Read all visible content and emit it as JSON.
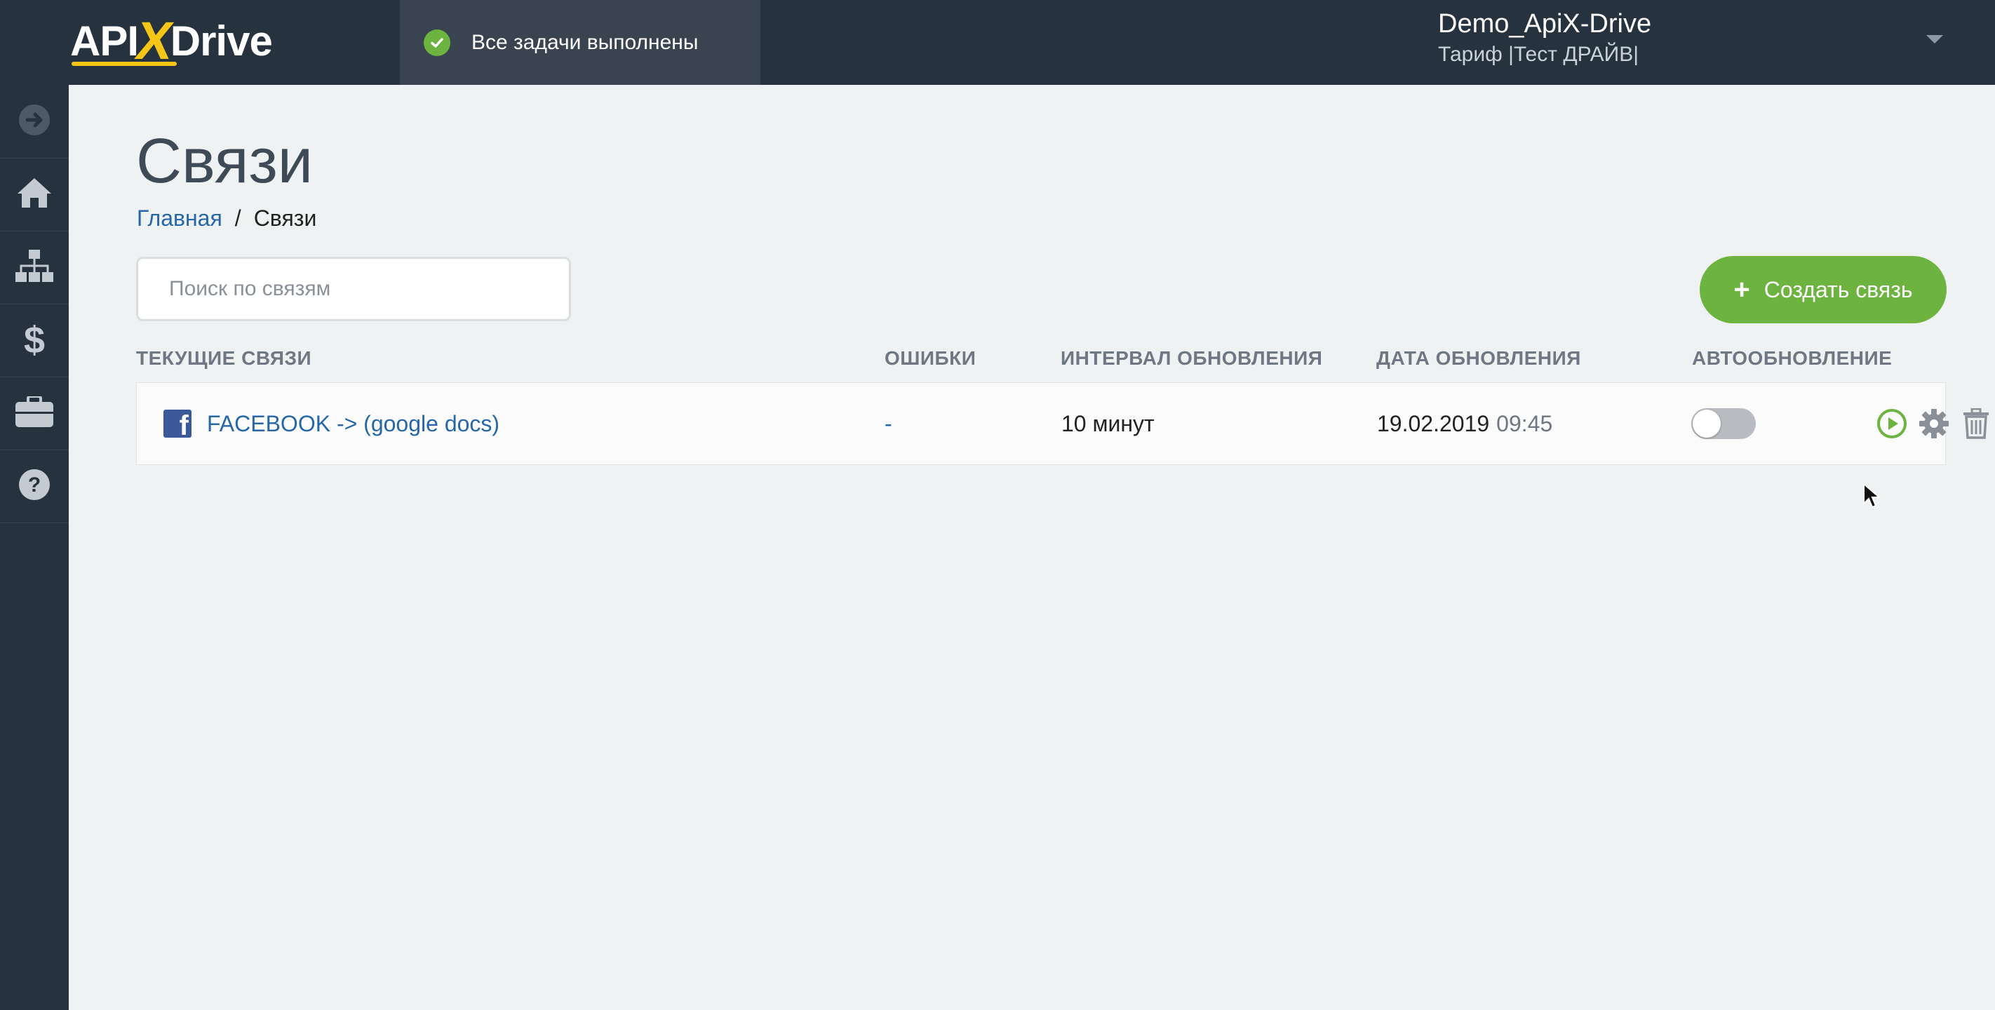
{
  "header": {
    "logo_left": "API",
    "logo_x": "X",
    "logo_right": "Drive",
    "status_text": "Все задачи выполнены",
    "user_name": "Demo_ApiX-Drive",
    "user_plan": "Тариф |Тест ДРАЙВ|"
  },
  "sidebar": {
    "items": [
      {
        "icon": "arrow-right-circle-icon"
      },
      {
        "icon": "home-icon"
      },
      {
        "icon": "sitemap-icon"
      },
      {
        "icon": "dollar-icon"
      },
      {
        "icon": "briefcase-icon"
      },
      {
        "icon": "help-icon"
      }
    ]
  },
  "page": {
    "title": "Связи",
    "breadcrumb": {
      "home": "Главная",
      "separator": "/",
      "current": "Связи"
    },
    "search_placeholder": "Поиск по связям",
    "create_button": "Создать связь",
    "create_button_plus": "+"
  },
  "table": {
    "columns": [
      "ТЕКУЩИЕ СВЯЗИ",
      "ОШИБКИ",
      "ИНТЕРВАЛ ОБНОВЛЕНИЯ",
      "ДАТА ОБНОВЛЕНИЯ",
      "АВТООБНОВЛЕНИЕ"
    ],
    "rows": [
      {
        "source_icon": "facebook-icon",
        "name": "FACEBOOK -> (google docs)",
        "errors": "-",
        "interval": "10 минут",
        "date": "19.02.2019",
        "time": "09:45",
        "autoupdate": false
      }
    ]
  },
  "colors": {
    "topbar": "#27323f",
    "accent_green": "#6cb33f",
    "link_blue": "#2667a8",
    "logo_yellow": "#f5c518"
  }
}
